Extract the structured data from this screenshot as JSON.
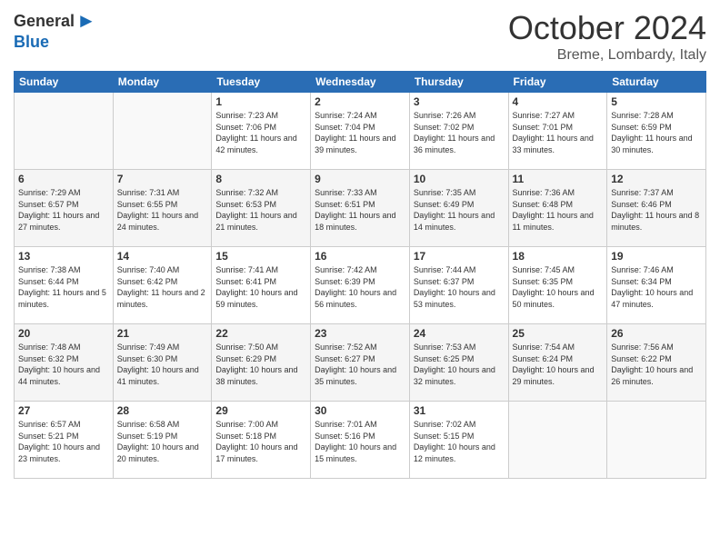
{
  "header": {
    "logo_general": "General",
    "logo_blue": "Blue",
    "month_title": "October 2024",
    "location": "Breme, Lombardy, Italy"
  },
  "days_of_week": [
    "Sunday",
    "Monday",
    "Tuesday",
    "Wednesday",
    "Thursday",
    "Friday",
    "Saturday"
  ],
  "weeks": [
    [
      {
        "day": "",
        "info": ""
      },
      {
        "day": "",
        "info": ""
      },
      {
        "day": "1",
        "info": "Sunrise: 7:23 AM\nSunset: 7:06 PM\nDaylight: 11 hours and 42 minutes."
      },
      {
        "day": "2",
        "info": "Sunrise: 7:24 AM\nSunset: 7:04 PM\nDaylight: 11 hours and 39 minutes."
      },
      {
        "day": "3",
        "info": "Sunrise: 7:26 AM\nSunset: 7:02 PM\nDaylight: 11 hours and 36 minutes."
      },
      {
        "day": "4",
        "info": "Sunrise: 7:27 AM\nSunset: 7:01 PM\nDaylight: 11 hours and 33 minutes."
      },
      {
        "day": "5",
        "info": "Sunrise: 7:28 AM\nSunset: 6:59 PM\nDaylight: 11 hours and 30 minutes."
      }
    ],
    [
      {
        "day": "6",
        "info": "Sunrise: 7:29 AM\nSunset: 6:57 PM\nDaylight: 11 hours and 27 minutes."
      },
      {
        "day": "7",
        "info": "Sunrise: 7:31 AM\nSunset: 6:55 PM\nDaylight: 11 hours and 24 minutes."
      },
      {
        "day": "8",
        "info": "Sunrise: 7:32 AM\nSunset: 6:53 PM\nDaylight: 11 hours and 21 minutes."
      },
      {
        "day": "9",
        "info": "Sunrise: 7:33 AM\nSunset: 6:51 PM\nDaylight: 11 hours and 18 minutes."
      },
      {
        "day": "10",
        "info": "Sunrise: 7:35 AM\nSunset: 6:49 PM\nDaylight: 11 hours and 14 minutes."
      },
      {
        "day": "11",
        "info": "Sunrise: 7:36 AM\nSunset: 6:48 PM\nDaylight: 11 hours and 11 minutes."
      },
      {
        "day": "12",
        "info": "Sunrise: 7:37 AM\nSunset: 6:46 PM\nDaylight: 11 hours and 8 minutes."
      }
    ],
    [
      {
        "day": "13",
        "info": "Sunrise: 7:38 AM\nSunset: 6:44 PM\nDaylight: 11 hours and 5 minutes."
      },
      {
        "day": "14",
        "info": "Sunrise: 7:40 AM\nSunset: 6:42 PM\nDaylight: 11 hours and 2 minutes."
      },
      {
        "day": "15",
        "info": "Sunrise: 7:41 AM\nSunset: 6:41 PM\nDaylight: 10 hours and 59 minutes."
      },
      {
        "day": "16",
        "info": "Sunrise: 7:42 AM\nSunset: 6:39 PM\nDaylight: 10 hours and 56 minutes."
      },
      {
        "day": "17",
        "info": "Sunrise: 7:44 AM\nSunset: 6:37 PM\nDaylight: 10 hours and 53 minutes."
      },
      {
        "day": "18",
        "info": "Sunrise: 7:45 AM\nSunset: 6:35 PM\nDaylight: 10 hours and 50 minutes."
      },
      {
        "day": "19",
        "info": "Sunrise: 7:46 AM\nSunset: 6:34 PM\nDaylight: 10 hours and 47 minutes."
      }
    ],
    [
      {
        "day": "20",
        "info": "Sunrise: 7:48 AM\nSunset: 6:32 PM\nDaylight: 10 hours and 44 minutes."
      },
      {
        "day": "21",
        "info": "Sunrise: 7:49 AM\nSunset: 6:30 PM\nDaylight: 10 hours and 41 minutes."
      },
      {
        "day": "22",
        "info": "Sunrise: 7:50 AM\nSunset: 6:29 PM\nDaylight: 10 hours and 38 minutes."
      },
      {
        "day": "23",
        "info": "Sunrise: 7:52 AM\nSunset: 6:27 PM\nDaylight: 10 hours and 35 minutes."
      },
      {
        "day": "24",
        "info": "Sunrise: 7:53 AM\nSunset: 6:25 PM\nDaylight: 10 hours and 32 minutes."
      },
      {
        "day": "25",
        "info": "Sunrise: 7:54 AM\nSunset: 6:24 PM\nDaylight: 10 hours and 29 minutes."
      },
      {
        "day": "26",
        "info": "Sunrise: 7:56 AM\nSunset: 6:22 PM\nDaylight: 10 hours and 26 minutes."
      }
    ],
    [
      {
        "day": "27",
        "info": "Sunrise: 6:57 AM\nSunset: 5:21 PM\nDaylight: 10 hours and 23 minutes."
      },
      {
        "day": "28",
        "info": "Sunrise: 6:58 AM\nSunset: 5:19 PM\nDaylight: 10 hours and 20 minutes."
      },
      {
        "day": "29",
        "info": "Sunrise: 7:00 AM\nSunset: 5:18 PM\nDaylight: 10 hours and 17 minutes."
      },
      {
        "day": "30",
        "info": "Sunrise: 7:01 AM\nSunset: 5:16 PM\nDaylight: 10 hours and 15 minutes."
      },
      {
        "day": "31",
        "info": "Sunrise: 7:02 AM\nSunset: 5:15 PM\nDaylight: 10 hours and 12 minutes."
      },
      {
        "day": "",
        "info": ""
      },
      {
        "day": "",
        "info": ""
      }
    ]
  ]
}
